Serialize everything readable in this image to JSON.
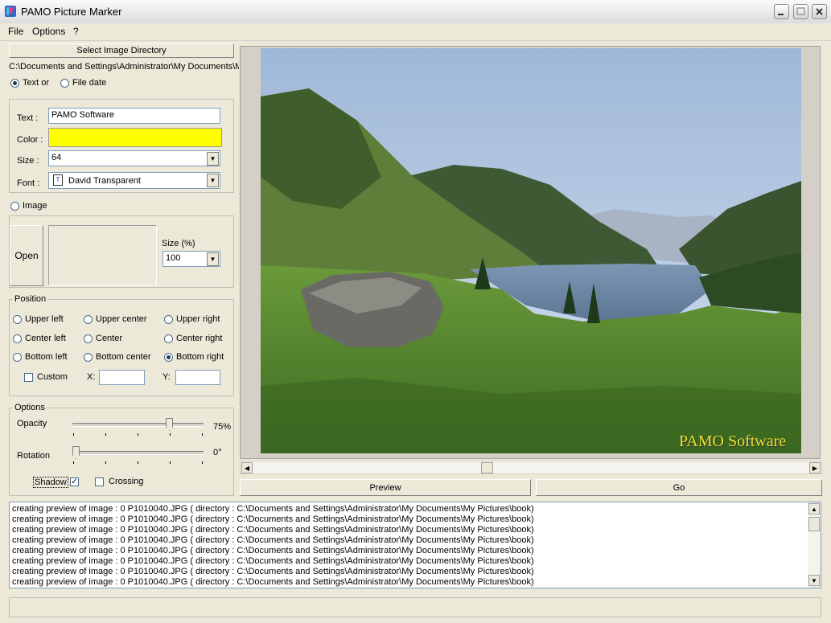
{
  "window": {
    "title": "PAMO Picture Marker"
  },
  "menu": {
    "file": "File",
    "options": "Options",
    "help": "?"
  },
  "left": {
    "select_dir_button": "Select Image Directory",
    "directory_path": "C:\\Documents and Settings\\Administrator\\My Documents\\My",
    "text_radio": "Text or",
    "file_date_radio": "File date",
    "text_label": "Text :",
    "text_value": "PAMO Software",
    "color_label": "Color :",
    "color_value": "#ffff00",
    "size_label": "Size :",
    "size_value": "64",
    "font_label": "Font :",
    "font_value": "David Transparent",
    "image_radio": "Image",
    "open_button": "Open",
    "size_pct_label": "Size (%)",
    "size_pct_value": "100",
    "position": {
      "legend": "Position",
      "upper_left": "Upper left",
      "upper_center": "Upper center",
      "upper_right": "Upper right",
      "center_left": "Center left",
      "center": "Center",
      "center_right": "Center right",
      "bottom_left": "Bottom left",
      "bottom_center": "Bottom center",
      "bottom_right": "Bottom right",
      "custom": "Custom",
      "x_label": "X:",
      "y_label": "Y:"
    },
    "options": {
      "legend": "Options",
      "opacity_label": "Opacity",
      "opacity_value": "75%",
      "opacity_level": 0.75,
      "rotation_label": "Rotation",
      "rotation_value": "0°",
      "rotation_level": 0,
      "shadow_label": "Shadow",
      "crossing_label": "Crossing"
    }
  },
  "preview": {
    "watermark": "PAMO Software",
    "preview_button": "Preview",
    "go_button": "Go"
  },
  "log": {
    "lines": [
      "creating preview of image : 0 P1010040.JPG ( directory : C:\\Documents and Settings\\Administrator\\My Documents\\My Pictures\\book)",
      "creating preview of image : 0 P1010040.JPG ( directory : C:\\Documents and Settings\\Administrator\\My Documents\\My Pictures\\book)",
      "creating preview of image : 0 P1010040.JPG ( directory : C:\\Documents and Settings\\Administrator\\My Documents\\My Pictures\\book)",
      "creating preview of image : 0 P1010040.JPG ( directory : C:\\Documents and Settings\\Administrator\\My Documents\\My Pictures\\book)",
      "creating preview of image : 0 P1010040.JPG ( directory : C:\\Documents and Settings\\Administrator\\My Documents\\My Pictures\\book)",
      "creating preview of image : 0 P1010040.JPG ( directory : C:\\Documents and Settings\\Administrator\\My Documents\\My Pictures\\book)",
      "creating preview of image : 0 P1010040.JPG ( directory : C:\\Documents and Settings\\Administrator\\My Documents\\My Pictures\\book)",
      "creating preview of image : 0 P1010040.JPG ( directory : C:\\Documents and Settings\\Administrator\\My Documents\\My Pictures\\book)"
    ]
  },
  "colors": {
    "watermark": "#e8e030",
    "sky": "#a8c0dc",
    "grass": "#4d7a2c"
  }
}
